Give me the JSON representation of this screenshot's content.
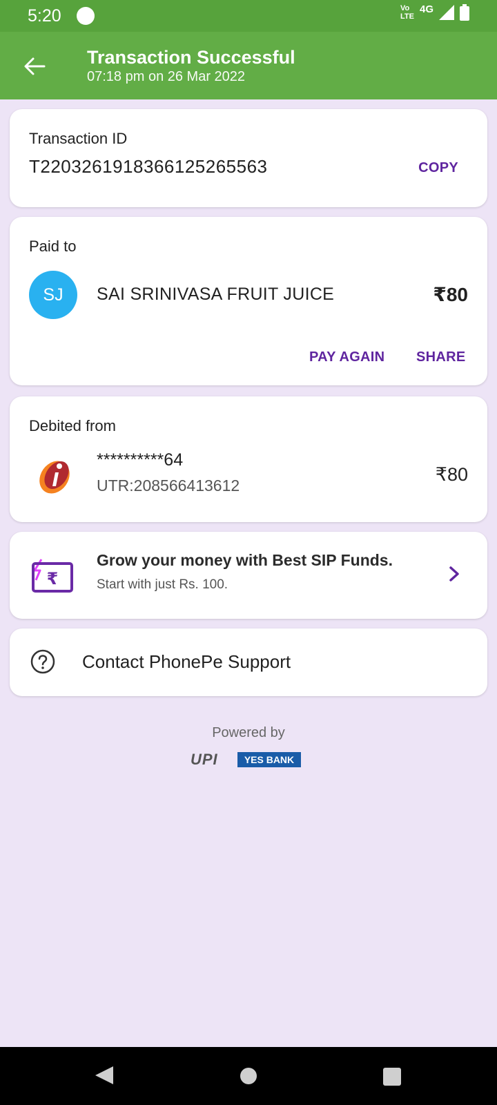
{
  "status_bar": {
    "time": "5:20",
    "volte_top": "Vo",
    "volte_bottom": "LTE",
    "network": "4G"
  },
  "header": {
    "title": "Transaction Successful",
    "subtitle": "07:18 pm on 26 Mar 2022",
    "colors": {
      "statusbar": "#57a33c",
      "header": "#62ad46"
    }
  },
  "transaction": {
    "label": "Transaction ID",
    "id": "T2203261918366125265563",
    "copy_label": "COPY"
  },
  "paid_to": {
    "label": "Paid to",
    "initials": "SJ",
    "name": "SAI SRINIVASA FRUIT JUICE",
    "amount": "₹80",
    "pay_again_label": "PAY AGAIN",
    "share_label": "SHARE"
  },
  "debited_from": {
    "label": "Debited from",
    "account": "**********64",
    "utr": "UTR:208566413612",
    "amount": "₹80",
    "bank_icon": "icici-bank-icon"
  },
  "promo": {
    "title": "Grow your money with Best SIP Funds.",
    "subtitle": "Start with just Rs. 100.",
    "icon": "sip-rupee-card-icon"
  },
  "support": {
    "label": "Contact PhonePe Support"
  },
  "footer": {
    "powered_by": "Powered by",
    "upi_text": "UPI",
    "bank_text": "YES BANK"
  },
  "accent_color": "#5f259f"
}
